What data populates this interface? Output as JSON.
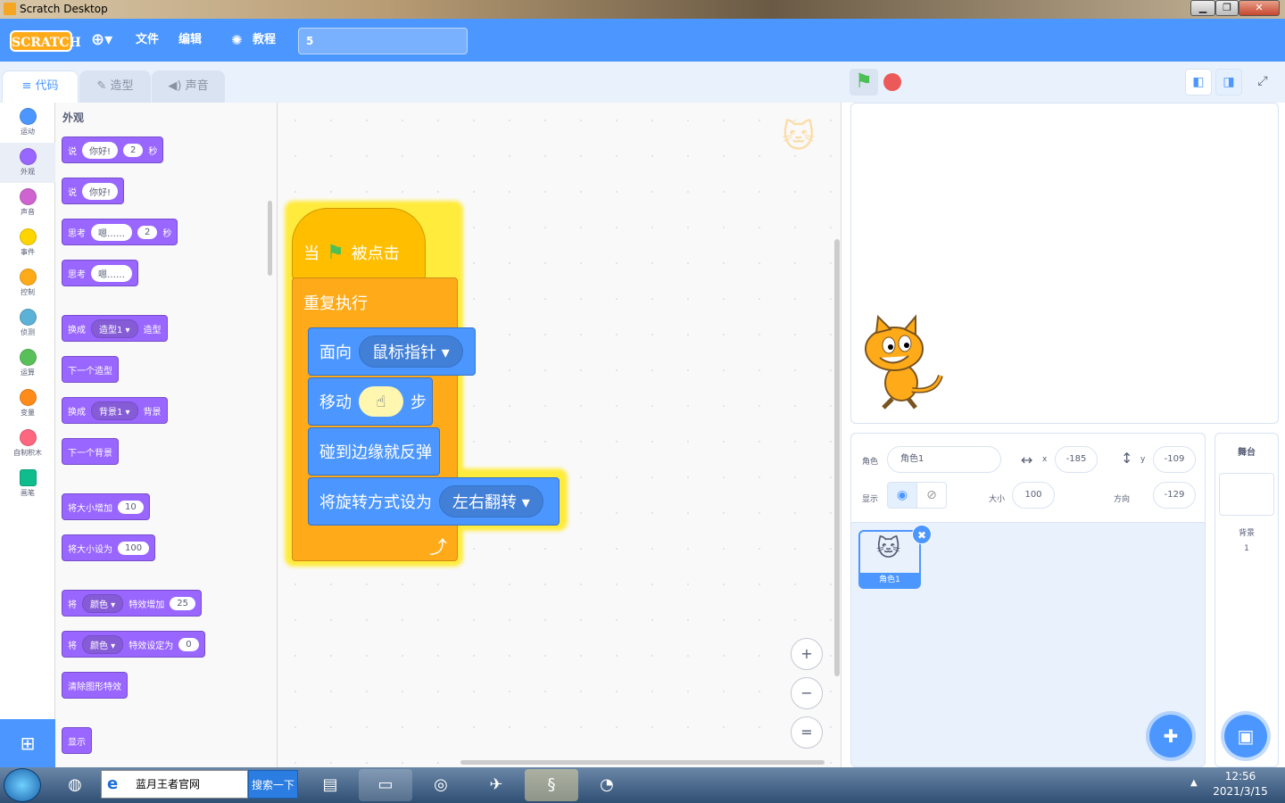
{
  "window": {
    "title": "Scratch Desktop",
    "minimize": "▁",
    "maximize": "❐",
    "close": "✕"
  },
  "menubar": {
    "logo": "SCRATCH",
    "language_icon": "globe-icon",
    "file": "文件",
    "edit": "编辑",
    "tutorials": "教程",
    "project_name": "5"
  },
  "tabs": {
    "code": "代码",
    "costumes": "造型",
    "sounds": "声音"
  },
  "categories": [
    {
      "label": "运动",
      "color": "#4c97ff"
    },
    {
      "label": "外观",
      "color": "#9966ff"
    },
    {
      "label": "声音",
      "color": "#cf63cf"
    },
    {
      "label": "事件",
      "color": "#ffd500"
    },
    {
      "label": "控制",
      "color": "#ffab19"
    },
    {
      "label": "侦测",
      "color": "#5cb1d6"
    },
    {
      "label": "运算",
      "color": "#59c059"
    },
    {
      "label": "变量",
      "color": "#ff8c1a"
    },
    {
      "label": "自制积木",
      "color": "#ff6680"
    },
    {
      "label": "画笔",
      "color": "#0fbd8c"
    }
  ],
  "palette": {
    "title": "外观",
    "say_secs": {
      "a": "说",
      "b": "你好!",
      "c": "2",
      "d": "秒"
    },
    "say": {
      "a": "说",
      "b": "你好!"
    },
    "think_secs": {
      "a": "思考",
      "b": "嗯……",
      "c": "2",
      "d": "秒"
    },
    "think": {
      "a": "思考",
      "b": "嗯……"
    },
    "switch_costume": {
      "a": "换成",
      "b": "造型1 ▾",
      "c": "造型"
    },
    "next_costume": "下一个造型",
    "switch_backdrop": {
      "a": "换成",
      "b": "背景1 ▾",
      "c": "背景"
    },
    "next_backdrop": "下一个背景",
    "change_size": {
      "a": "将大小增加",
      "b": "10"
    },
    "set_size": {
      "a": "将大小设为",
      "b": "100"
    },
    "change_effect": {
      "a": "将",
      "b": "颜色 ▾",
      "c": "特效增加",
      "d": "25"
    },
    "set_effect": {
      "a": "将",
      "b": "颜色 ▾",
      "c": "特效设定为",
      "d": "0"
    },
    "clear_effects": "清除图形特效",
    "show": "显示"
  },
  "script": {
    "hat": {
      "a": "当",
      "b": "被点击"
    },
    "forever": "重复执行",
    "point": {
      "a": "面向",
      "b": "鼠标指针 ▾"
    },
    "move": {
      "a": "移动",
      "b": "步"
    },
    "bounce": "碰到边缘就反弹",
    "rotation": {
      "a": "将旋转方式设为",
      "b": "左右翻转 ▾"
    }
  },
  "zoom": {
    "in": "+",
    "out": "−",
    "reset": "="
  },
  "sprite_info": {
    "sprite_label": "角色",
    "sprite_name": "角色1",
    "x_label": "x",
    "x": "-185",
    "y_label": "y",
    "y": "-109",
    "show_label": "显示",
    "size_label": "大小",
    "size": "100",
    "direction_label": "方向",
    "direction": "-129"
  },
  "sprite_thumb": "角色1",
  "stage_panel": {
    "title": "舞台",
    "backdrops_label": "背景",
    "backdrops_count": "1"
  },
  "taskbar": {
    "address": "蓝月王者官网",
    "search": "搜索一下",
    "time": "12:56",
    "date": "2021/3/15"
  }
}
